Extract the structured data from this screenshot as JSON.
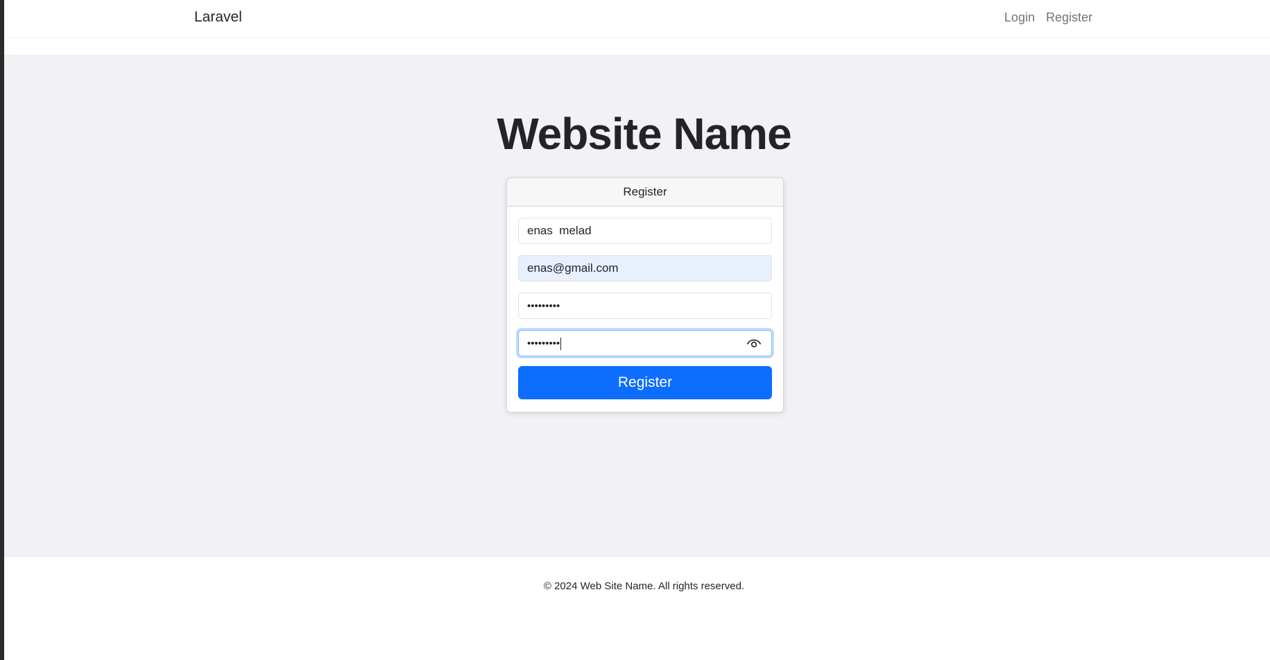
{
  "navbar": {
    "brand": "Laravel",
    "links": [
      "Login",
      "Register"
    ]
  },
  "hero": {
    "title": "Website Name"
  },
  "form": {
    "header": "Register",
    "name_value": "enas  melad",
    "email_value": "enas@gmail.com",
    "password_value": "•••••••••",
    "confirm_password_value": "•••••••••",
    "submit_label": "Register"
  },
  "footer": {
    "text": "© 2024 Web Site Name. All rights reserved."
  },
  "colors": {
    "primary": "#0d6efd",
    "page_background": "#f1f1f6",
    "autofill_background": "#e8f0fe"
  },
  "icons": {
    "password_toggle": "eye-icon"
  }
}
